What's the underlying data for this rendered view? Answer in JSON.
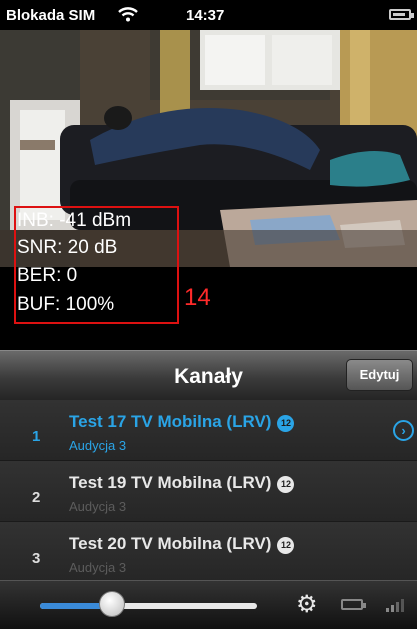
{
  "status_bar": {
    "carrier": "Blokada SIM",
    "time": "14:37",
    "wifi_icon": "wifi-icon",
    "battery_icon": "battery-icon"
  },
  "stats": {
    "inb": "INB: -41 dBm",
    "snr": "SNR: 20 dB",
    "ber": "BER: 0",
    "buf": "BUF: 100%",
    "annotation_number": "14",
    "annotation_color": "#ff2a2a"
  },
  "nav": {
    "title": "Kanały",
    "edit_label": "Edytuj"
  },
  "channels": [
    {
      "number": "1",
      "name": "Test 17 TV Mobilna (LRV)",
      "rating": "12",
      "subtitle": "Audycja 3",
      "active": true
    },
    {
      "number": "2",
      "name": "Test 19 TV Mobilna (LRV)",
      "rating": "12",
      "subtitle": "Audycja 3",
      "active": false
    },
    {
      "number": "3",
      "name": "Test 20 TV Mobilna (LRV)",
      "rating": "12",
      "subtitle": "Audycja 3",
      "active": false
    }
  ],
  "bottom_bar": {
    "volume_fraction": 0.33,
    "settings_icon": "gear-icon",
    "battery_icon": "battery-icon",
    "signal_icon": "signal-icon"
  },
  "colors": {
    "accent": "#2aa4e6",
    "highlight_box": "#dd1111",
    "slider_fill": "#3a8ad8"
  }
}
